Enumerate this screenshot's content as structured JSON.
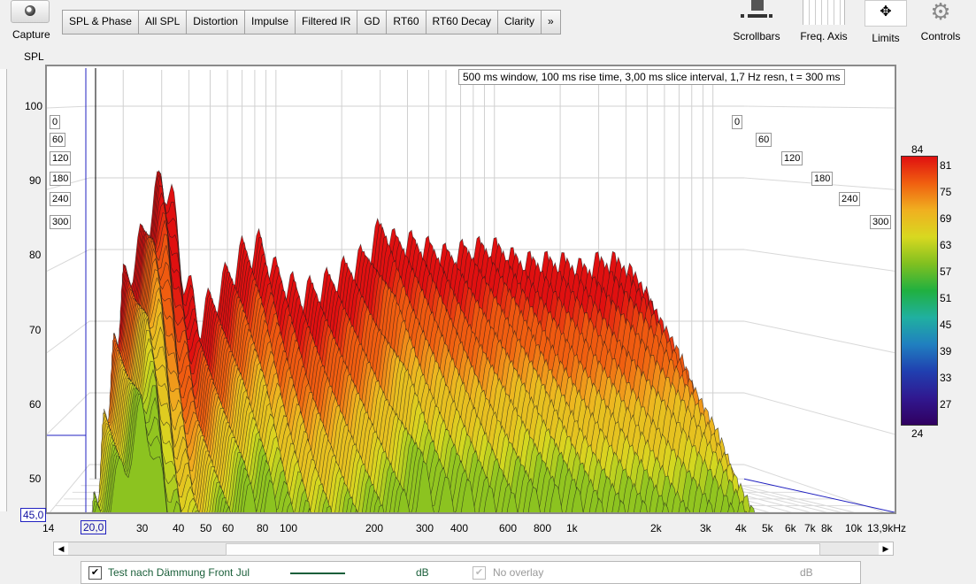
{
  "toolbar": {
    "capture_label": "Capture",
    "tabs": [
      "SPL & Phase",
      "All SPL",
      "Distortion",
      "Impulse",
      "Filtered IR",
      "GD",
      "RT60",
      "RT60 Decay",
      "Clarity",
      "»"
    ],
    "tools": [
      {
        "label": "Scrollbars",
        "icon": "scrollbars-icon"
      },
      {
        "label": "Freq. Axis",
        "icon": "freq-axis-icon"
      },
      {
        "label": "Limits",
        "icon": "limits-icon"
      },
      {
        "label": "Controls",
        "icon": "gear-icon"
      }
    ]
  },
  "plot": {
    "info": "500 ms window, 100 ms rise time, 3,00 ms slice interval, 1,7 Hz resn, t = 300 ms",
    "y_axis_title": "SPL",
    "y_ticks": [
      "100",
      "90",
      "80",
      "70",
      "60",
      "50"
    ],
    "y_cursor": "45,0",
    "x_ticks": [
      "14",
      "20,0",
      "30",
      "40",
      "50",
      "60",
      "80",
      "100",
      "200",
      "300",
      "400",
      "600",
      "800",
      "1k",
      "2k",
      "3k",
      "4k",
      "5k",
      "6k",
      "7k",
      "8k",
      "10k",
      "13,9kHz"
    ],
    "time_ticks_left": [
      "0",
      "60",
      "120",
      "180",
      "240",
      "300"
    ],
    "time_ticks_right": [
      "0",
      "60",
      "120",
      "180",
      "240",
      "300"
    ]
  },
  "colorbar": {
    "max": "84",
    "min": "24",
    "ticks": [
      "81",
      "75",
      "69",
      "63",
      "57",
      "51",
      "45",
      "39",
      "33",
      "27"
    ],
    "colors": [
      "#e01010",
      "#f06010",
      "#f0b020",
      "#d8d820",
      "#80c020",
      "#20b040",
      "#20b0a0",
      "#2080c0",
      "#2040b0",
      "#301890",
      "#300060"
    ]
  },
  "chart_data": {
    "type": "waterfall",
    "title": "",
    "xlabel": "",
    "ylabel": "SPL",
    "xscale": "log",
    "xlim": [
      14,
      13900
    ],
    "ylim": [
      45,
      105
    ],
    "time_range_ms": [
      0,
      300
    ],
    "slice_interval_ms": 3.0,
    "series": [
      {
        "name": "Test nach Dämmung Front Jul",
        "x": [
          20,
          25,
          30,
          33,
          38,
          45,
          55,
          70,
          85,
          100,
          130,
          160,
          200,
          250,
          300,
          350,
          400,
          500,
          600,
          800,
          1000,
          1300,
          1600,
          2000,
          2500,
          3000,
          3500,
          4000,
          5000,
          6000
        ],
        "y": [
          75,
          82,
          90,
          88,
          76,
          70,
          74,
          79,
          80,
          76,
          73,
          74,
          76,
          78,
          82,
          80,
          80,
          79,
          78,
          79,
          79,
          77,
          77,
          77,
          76,
          77,
          77,
          76,
          72,
          60
        ]
      }
    ]
  },
  "legend": {
    "trace_label": "Test nach Dämmung Front Jul",
    "trace_unit": "dB",
    "overlay_label": "No overlay",
    "overlay_unit": "dB",
    "trace_color": "#1a5f3a"
  }
}
